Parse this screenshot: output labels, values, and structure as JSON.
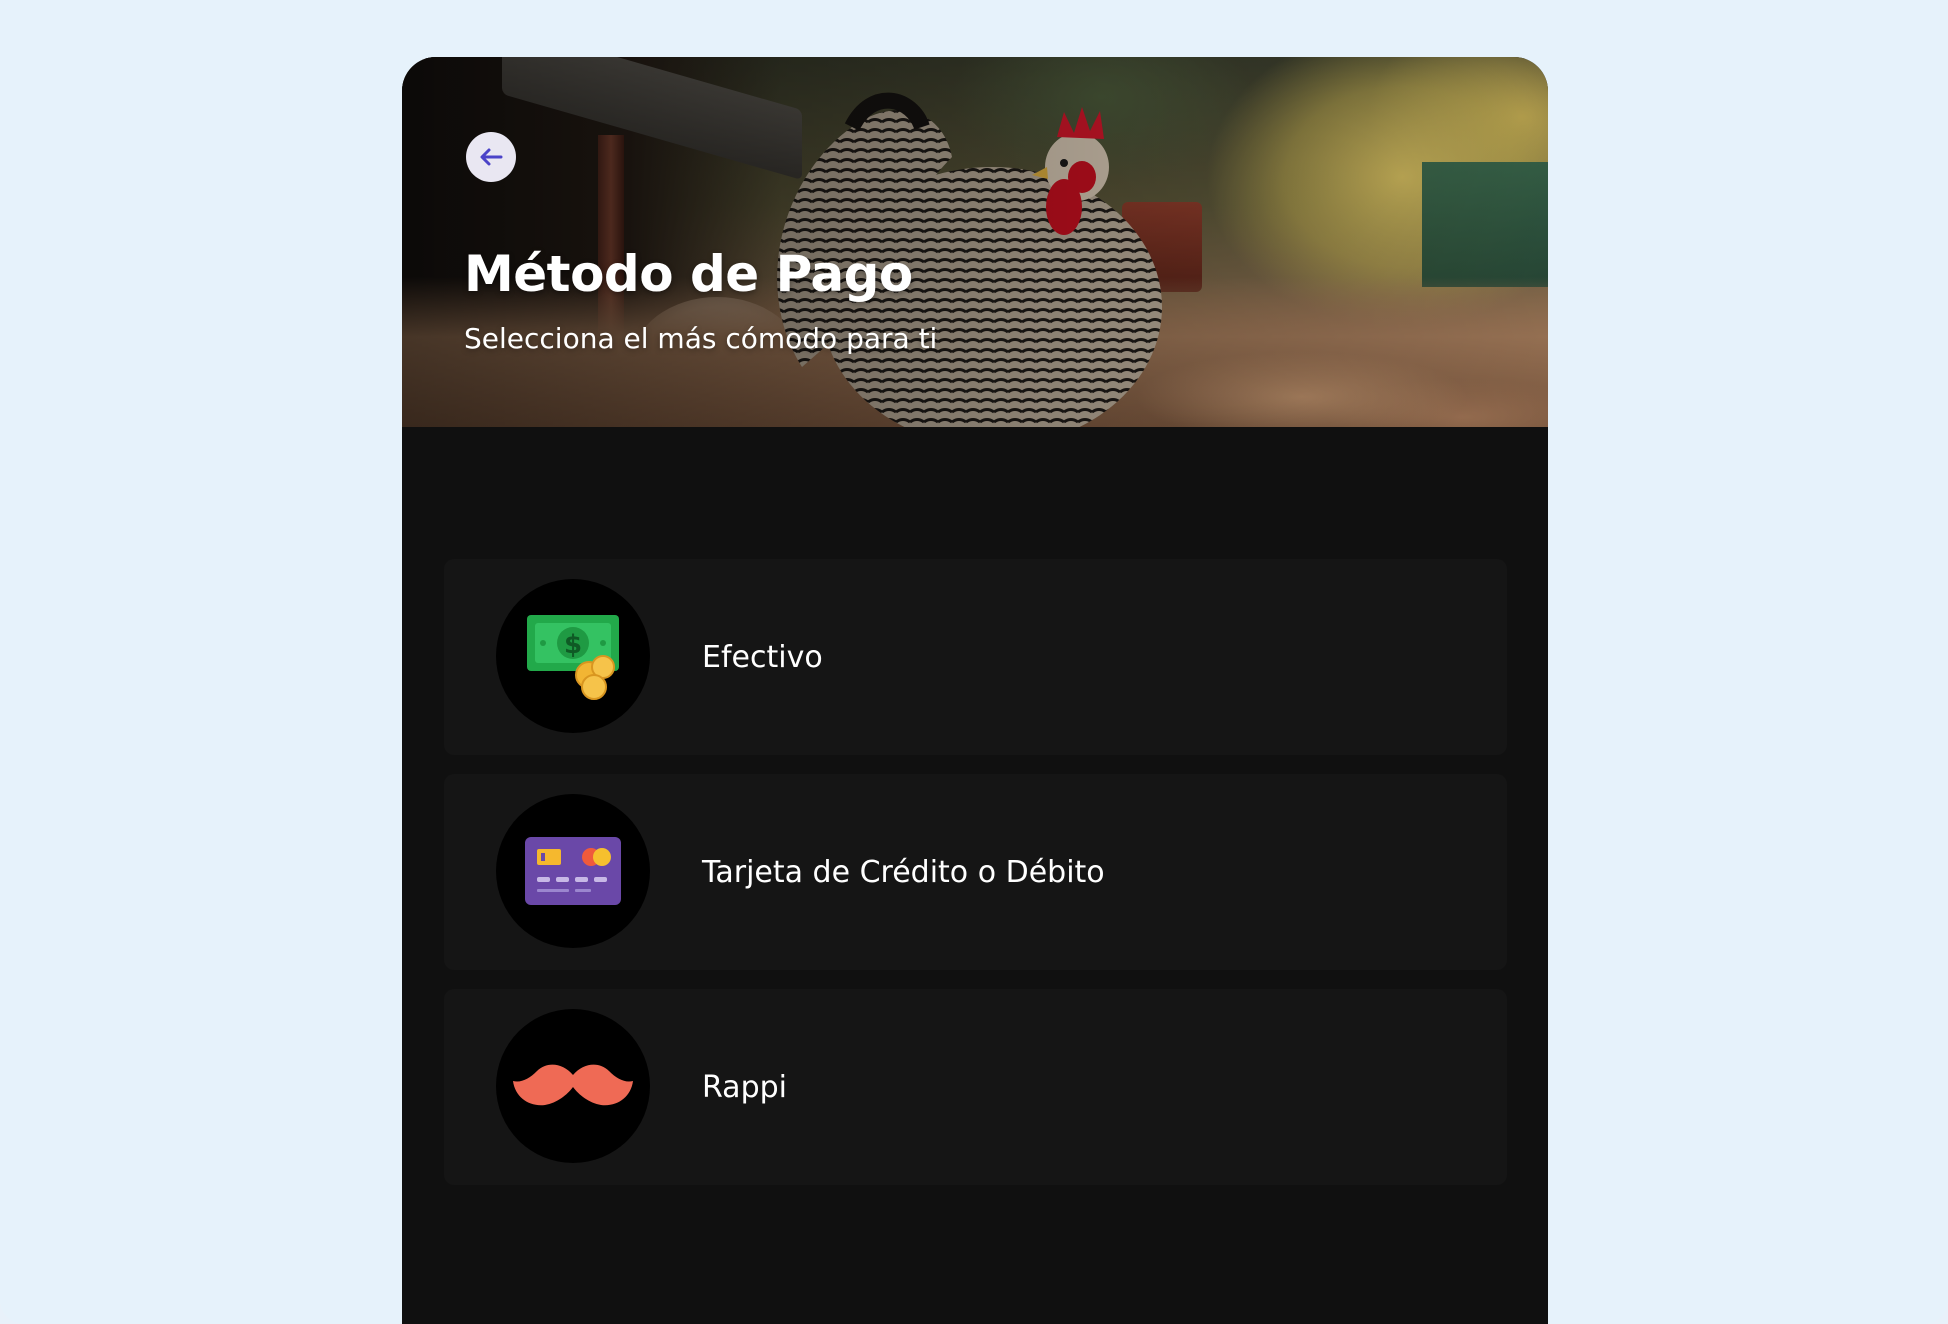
{
  "header": {
    "title": "Método de Pago",
    "subtitle": "Selecciona el más cómodo para ti",
    "back_icon": "arrow-left-icon",
    "accent_color": "#4b43c8"
  },
  "payment_methods": [
    {
      "label": "Efectivo",
      "icon": "cash-coins-icon"
    },
    {
      "label": "Tarjeta de Crédito o Débito",
      "icon": "credit-card-icon"
    },
    {
      "label": "Rappi",
      "icon": "mustache-icon"
    }
  ],
  "colors": {
    "page_background": "#e6f2fb",
    "panel_background": "#101010",
    "item_background": "#151515",
    "text": "#ffffff",
    "cash_green": "#22a94a",
    "card_purple": "#6a48a8",
    "rappi_orange": "#ef6a55"
  }
}
